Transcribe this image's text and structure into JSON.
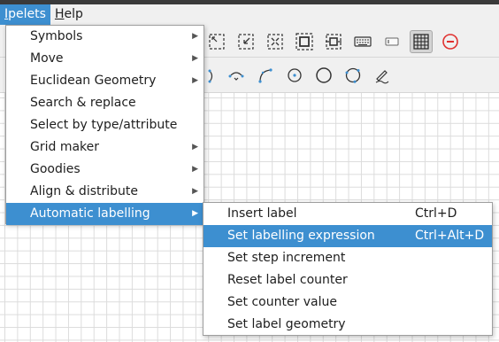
{
  "menubar": {
    "items": [
      {
        "label": "Ipelets",
        "mnemonic": "I",
        "rest": "pelets",
        "active": true
      },
      {
        "label": "Help",
        "mnemonic": "H",
        "rest": "elp",
        "active": false
      }
    ]
  },
  "ipelets_menu": {
    "items": [
      {
        "label": "Symbols",
        "has_submenu": true
      },
      {
        "label": "Move",
        "has_submenu": true
      },
      {
        "label": "Euclidean Geometry",
        "has_submenu": true
      },
      {
        "label": "Search & replace",
        "has_submenu": false
      },
      {
        "label": "Select by type/attribute",
        "has_submenu": false
      },
      {
        "label": "Grid maker",
        "has_submenu": true
      },
      {
        "label": "Goodies",
        "has_submenu": true
      },
      {
        "label": "Align & distribute",
        "has_submenu": true
      },
      {
        "label": "Automatic labelling",
        "has_submenu": true,
        "highlighted": true
      }
    ]
  },
  "labelling_submenu": {
    "items": [
      {
        "label": "Insert label",
        "shortcut": "Ctrl+D"
      },
      {
        "label": "Set labelling expression",
        "shortcut": "Ctrl+Alt+D",
        "highlighted": true
      },
      {
        "label": "Set step increment",
        "shortcut": ""
      },
      {
        "label": "Reset label counter",
        "shortcut": ""
      },
      {
        "label": "Set counter value",
        "shortcut": ""
      },
      {
        "label": "Set label geometry",
        "shortcut": ""
      }
    ]
  },
  "toolbar": {
    "row1_icons": [
      "fit-page-icon",
      "fit-objects-icon",
      "fit-selection-icon",
      "zoom-in-icon",
      "zoom-out-icon",
      "keyboard-icon",
      "text-field-icon",
      "grid-toggle-icon",
      "stop-icon"
    ],
    "row2_icons": [
      "arc-icon",
      "spline-icon",
      "curve-icon",
      "circle-center-icon",
      "circle-icon",
      "circle-three-points-icon",
      "pen-icon"
    ]
  },
  "colors": {
    "highlight": "#3d8fd0",
    "menu_bg": "#ffffff",
    "stop_red": "#e0312f"
  }
}
